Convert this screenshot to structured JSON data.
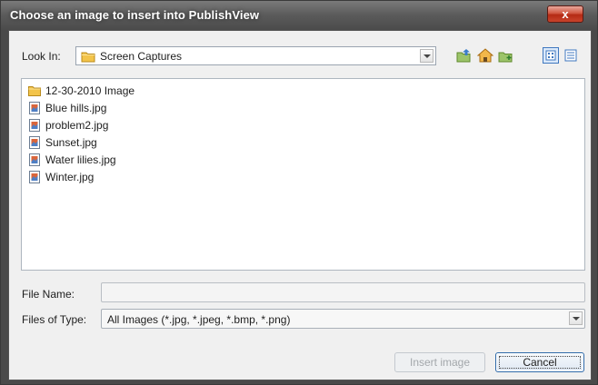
{
  "window": {
    "title": "Choose an image to insert into PublishView",
    "close_label": "x"
  },
  "lookin": {
    "label": "Look In:",
    "value": "Screen Captures",
    "icon": "folder-icon"
  },
  "toolbar": {
    "icons": [
      "up-folder-icon",
      "home-icon",
      "new-folder-icon"
    ],
    "view_icons": [
      "list-view-icon",
      "details-view-icon"
    ]
  },
  "files": [
    {
      "name": "12-30-2010 Image",
      "icon": "folder-icon"
    },
    {
      "name": "Blue hills.jpg",
      "icon": "image-file-icon"
    },
    {
      "name": "problem2.jpg",
      "icon": "image-file-icon"
    },
    {
      "name": "Sunset.jpg",
      "icon": "image-file-icon"
    },
    {
      "name": "Water lilies.jpg",
      "icon": "image-file-icon"
    },
    {
      "name": "Winter.jpg",
      "icon": "image-file-icon"
    }
  ],
  "file_name": {
    "label": "File Name:",
    "value": ""
  },
  "file_type": {
    "label": "Files of Type:",
    "value": "All Images (*.jpg, *.jpeg, *.bmp, *.png)"
  },
  "buttons": {
    "insert": "Insert image",
    "cancel": "Cancel"
  },
  "colors": {
    "titlebar": "#5a5a5a",
    "close": "#c8442c",
    "dialog_bg": "#f0f0f0",
    "folder": "#f3c44a",
    "accent": "#2f6aa9"
  }
}
